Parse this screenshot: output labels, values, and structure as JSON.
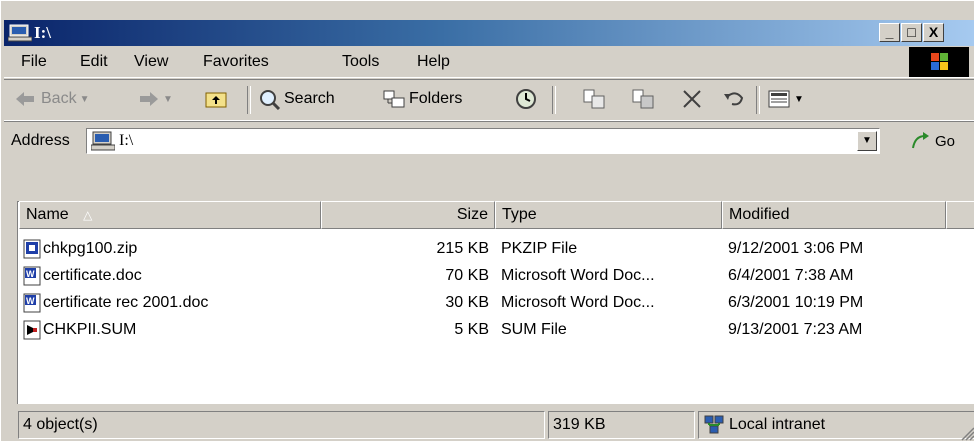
{
  "window": {
    "title": "I:\\"
  },
  "menu": [
    "File",
    "Edit",
    "View",
    "Favorites",
    "Tools",
    "Help"
  ],
  "toolbar": {
    "back": "Back",
    "search": "Search",
    "folders": "Folders"
  },
  "address": {
    "label": "Address",
    "value": "I:\\",
    "go": "Go"
  },
  "columns": {
    "name": "Name",
    "size": "Size",
    "type": "Type",
    "modified": "Modified"
  },
  "files": [
    {
      "name": "chkpg100.zip",
      "size": "215 KB",
      "type": "PKZIP File",
      "modified": "9/12/2001 3:06 PM",
      "icon": "zip-file-icon"
    },
    {
      "name": "certificate.doc",
      "size": "70 KB",
      "type": "Microsoft Word Doc...",
      "modified": "6/4/2001 7:38 AM",
      "icon": "word-doc-icon"
    },
    {
      "name": "certificate rec 2001.doc",
      "size": "30 KB",
      "type": "Microsoft Word Doc...",
      "modified": "6/3/2001 10:19 PM",
      "icon": "word-doc-icon"
    },
    {
      "name": "CHKPII.SUM",
      "size": "5 KB",
      "type": "SUM File",
      "modified": "9/13/2001 7:23 AM",
      "icon": "sum-file-icon"
    }
  ],
  "status": {
    "objects": "4 object(s)",
    "total_size": "319 KB",
    "zone": "Local intranet"
  },
  "colors": {
    "title_start": "#0a246a",
    "title_end": "#a6caf0",
    "face": "#d4d0c8"
  }
}
